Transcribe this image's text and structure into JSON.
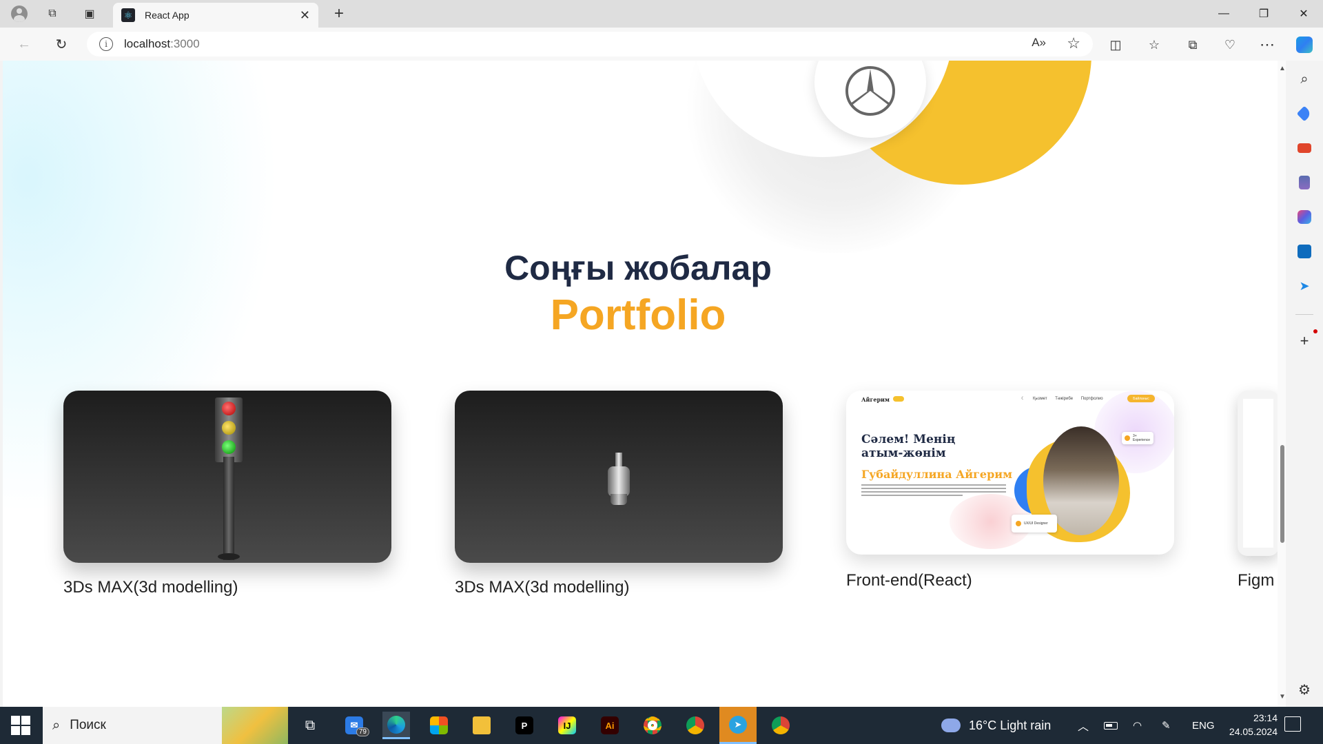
{
  "browser": {
    "tab_title": "React App",
    "url_host": "localhost",
    "url_port": ":3000",
    "window_controls": {
      "minimize": "—",
      "maximize": "❐",
      "close": "✕"
    }
  },
  "page": {
    "section_subtitle": "Соңғы жобалар",
    "section_title": "Portfolio",
    "projects": [
      {
        "label": "3Ds MAX(3d modelling)",
        "preview": "traffic-light-3d-model"
      },
      {
        "label": "3Ds MAX(3d modelling)",
        "preview": "samovar-3d-model"
      },
      {
        "label": "Front-end(React)",
        "preview": "portfolio-website-screenshot"
      },
      {
        "label": "Figm",
        "preview": "figma-design-screenshot"
      }
    ],
    "mini_site": {
      "brand": "Айгерим",
      "nav": "☾ Қызмет Тәжірибе Портфолио",
      "button": "Байланыс",
      "heading": "Сәлем! Менің атым-жөнім",
      "name": "Губайдуллина Айгерим",
      "chip_small": "3+ Experience",
      "chip_big": "UX/UI Designer"
    }
  },
  "taskbar": {
    "search_placeholder": "Поиск",
    "mail_badge": "79",
    "weather": "16°C  Light rain",
    "language": "ENG",
    "time": "23:14",
    "date": "24.05.2024"
  },
  "colors": {
    "accent_orange": "#f5a623",
    "heading_navy": "#1f2a44",
    "taskbar": "#1e2a36",
    "yellow_blob": "#f5c12e"
  }
}
